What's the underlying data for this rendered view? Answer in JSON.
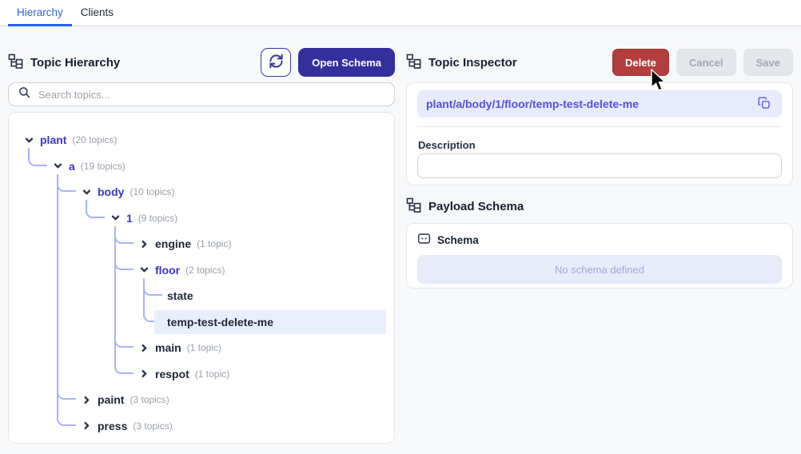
{
  "tabs": {
    "hierarchy": "Hierarchy",
    "clients": "Clients"
  },
  "left_panel": {
    "title": "Topic Hierarchy",
    "open_schema_label": "Open Schema",
    "search_placeholder": "Search topics...",
    "tree": {
      "nodes": [
        {
          "label": "plant",
          "count": "(20 topics)",
          "level": 0,
          "state": "expanded",
          "parent": null,
          "selected": false
        },
        {
          "label": "a",
          "count": "(19 topics)",
          "level": 1,
          "state": "expanded",
          "parent": 0,
          "selected": false
        },
        {
          "label": "body",
          "count": "(10 topics)",
          "level": 2,
          "state": "expanded",
          "parent": 1,
          "selected": false
        },
        {
          "label": "1",
          "count": "(9 topics)",
          "level": 3,
          "state": "expanded",
          "parent": 2,
          "selected": false
        },
        {
          "label": "engine",
          "count": "(1 topic)",
          "level": 4,
          "state": "collapsed",
          "parent": 3,
          "selected": false
        },
        {
          "label": "floor",
          "count": "(2 topics)",
          "level": 4,
          "state": "expanded",
          "parent": 3,
          "selected": false
        },
        {
          "label": "state",
          "count": "",
          "level": 5,
          "state": "leaf",
          "parent": 5,
          "selected": false
        },
        {
          "label": "temp-test-delete-me",
          "count": "",
          "level": 5,
          "state": "leaf",
          "parent": 5,
          "selected": true
        },
        {
          "label": "main",
          "count": "(1 topic)",
          "level": 4,
          "state": "collapsed",
          "parent": 3,
          "selected": false
        },
        {
          "label": "respot",
          "count": "(1 topic)",
          "level": 4,
          "state": "collapsed",
          "parent": 3,
          "selected": false
        },
        {
          "label": "paint",
          "count": "(3 topics)",
          "level": 2,
          "state": "collapsed",
          "parent": 1,
          "selected": false
        },
        {
          "label": "press",
          "count": "(3 topics)",
          "level": 2,
          "state": "collapsed",
          "parent": 1,
          "selected": false
        }
      ]
    }
  },
  "right_panel": {
    "title": "Topic Inspector",
    "delete_label": "Delete",
    "cancel_label": "Cancel",
    "save_label": "Save",
    "topic_path": "plant/a/body/1/floor/temp-test-delete-me",
    "description_label": "Description",
    "description_value": "",
    "payload_schema_title": "Payload Schema",
    "schema_section_title": "Schema",
    "schema_placeholder": "No schema defined"
  },
  "icons": {
    "hierarchy": "sitemap-glyph",
    "refresh": "⟳",
    "search": "🔍",
    "copy": "⧉",
    "chevron_down": "⌄",
    "chevron_right": "›",
    "schema_box": "box-with-dots"
  },
  "colors": {
    "tab_active": "#3565d4",
    "tab_underline": "#2563eb",
    "accent_indigo": "#3b35c6",
    "primary_button": "#332f9d",
    "delete_red": "#b43d3d",
    "disabled_gray": "#e3e6ea",
    "selected_row": "#e8eefb",
    "connector_line": "#a9b1f8",
    "path_pill_bg": "#e8ebfc",
    "path_text": "#554ee2",
    "schema_empty_bg": "#e8ebfa",
    "page_bg": "#f7f8fa"
  }
}
